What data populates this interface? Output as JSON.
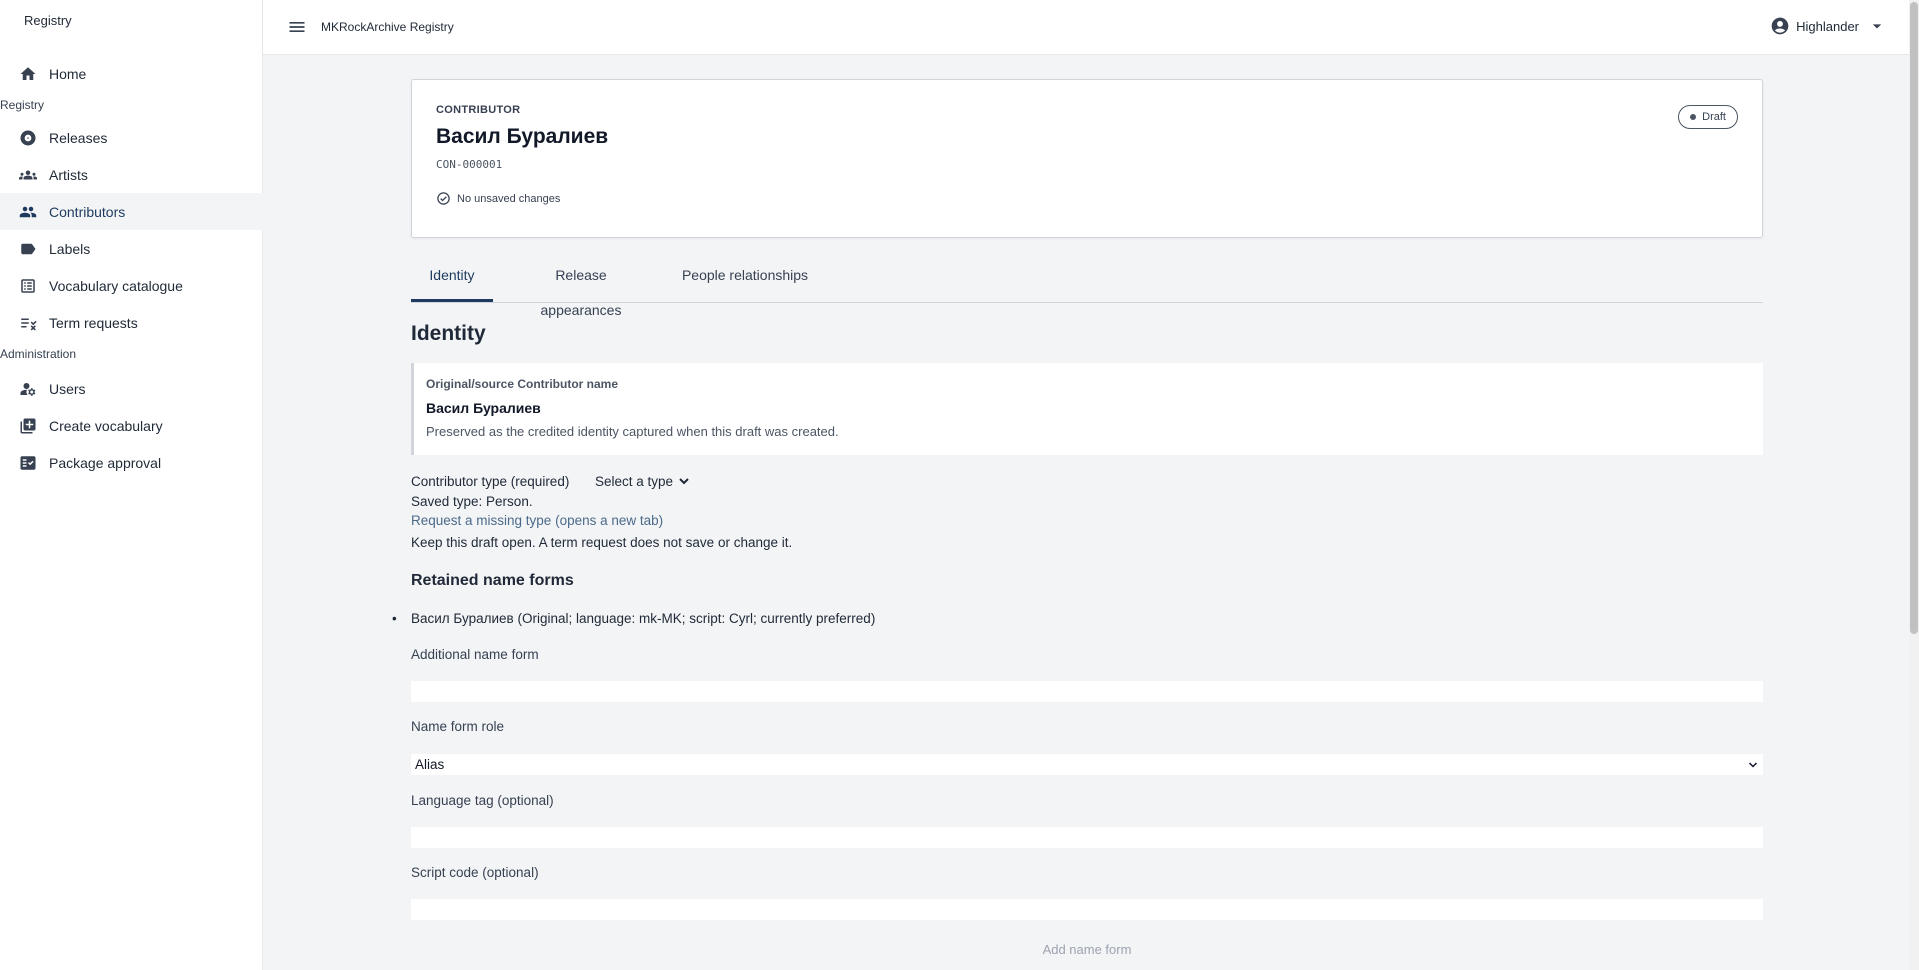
{
  "sidebar": {
    "brand": "Registry",
    "section_registry": "Registry",
    "section_admin": "Administration",
    "items": [
      {
        "label": "Home",
        "icon": "home-icon"
      },
      {
        "label": "Releases",
        "icon": "disc-icon"
      },
      {
        "label": "Artists",
        "icon": "group-icon"
      },
      {
        "label": "Contributors",
        "icon": "people-icon"
      },
      {
        "label": "Labels",
        "icon": "label-icon"
      },
      {
        "label": "Vocabulary catalogue",
        "icon": "list-icon"
      },
      {
        "label": "Term requests",
        "icon": "checklist-icon"
      },
      {
        "label": "Users",
        "icon": "manage-accounts-icon"
      },
      {
        "label": "Create vocabulary",
        "icon": "library-add-icon"
      },
      {
        "label": "Package approval",
        "icon": "fact-check-icon"
      }
    ]
  },
  "header": {
    "app_title": "MKRockArchive Registry",
    "user_name": "Highlander"
  },
  "record": {
    "kicker": "CONTRIBUTOR",
    "name": "Васил Буралиев",
    "id": "CON-000001",
    "save_status": "No unsaved changes",
    "badge": "Draft"
  },
  "tabs": [
    "Identity",
    "Release appearances",
    "People relationships"
  ],
  "identity": {
    "section_title": "Identity",
    "source_label": "Original/source Contributor name",
    "source_name": "Васил Буралиев",
    "source_desc": "Preserved as the credited identity captured when this draft was created.",
    "type_label": "Contributor type (required)",
    "type_value": "Select a type",
    "saved_type": "Saved type: Person.",
    "request_link": "Request a missing type (opens a new tab)",
    "draft_hint": "Keep this draft open. A term request does not save or change it.",
    "retained_title": "Retained name forms",
    "retained_forms": [
      "Васил Буралиев (Original; language: mk-MK; script: Cyrl; currently preferred)"
    ],
    "additional_label": "Additional name form",
    "additional_value": "",
    "role_label": "Name form role",
    "role_value": "Alias",
    "language_label": "Language tag (optional)",
    "language_value": "",
    "script_label": "Script code (optional)",
    "script_value": "",
    "add_button": "Add name form"
  },
  "colors": {
    "accent": "#1e3a5f",
    "link": "#4b6a8a",
    "page_bg": "#f3f4f6"
  }
}
